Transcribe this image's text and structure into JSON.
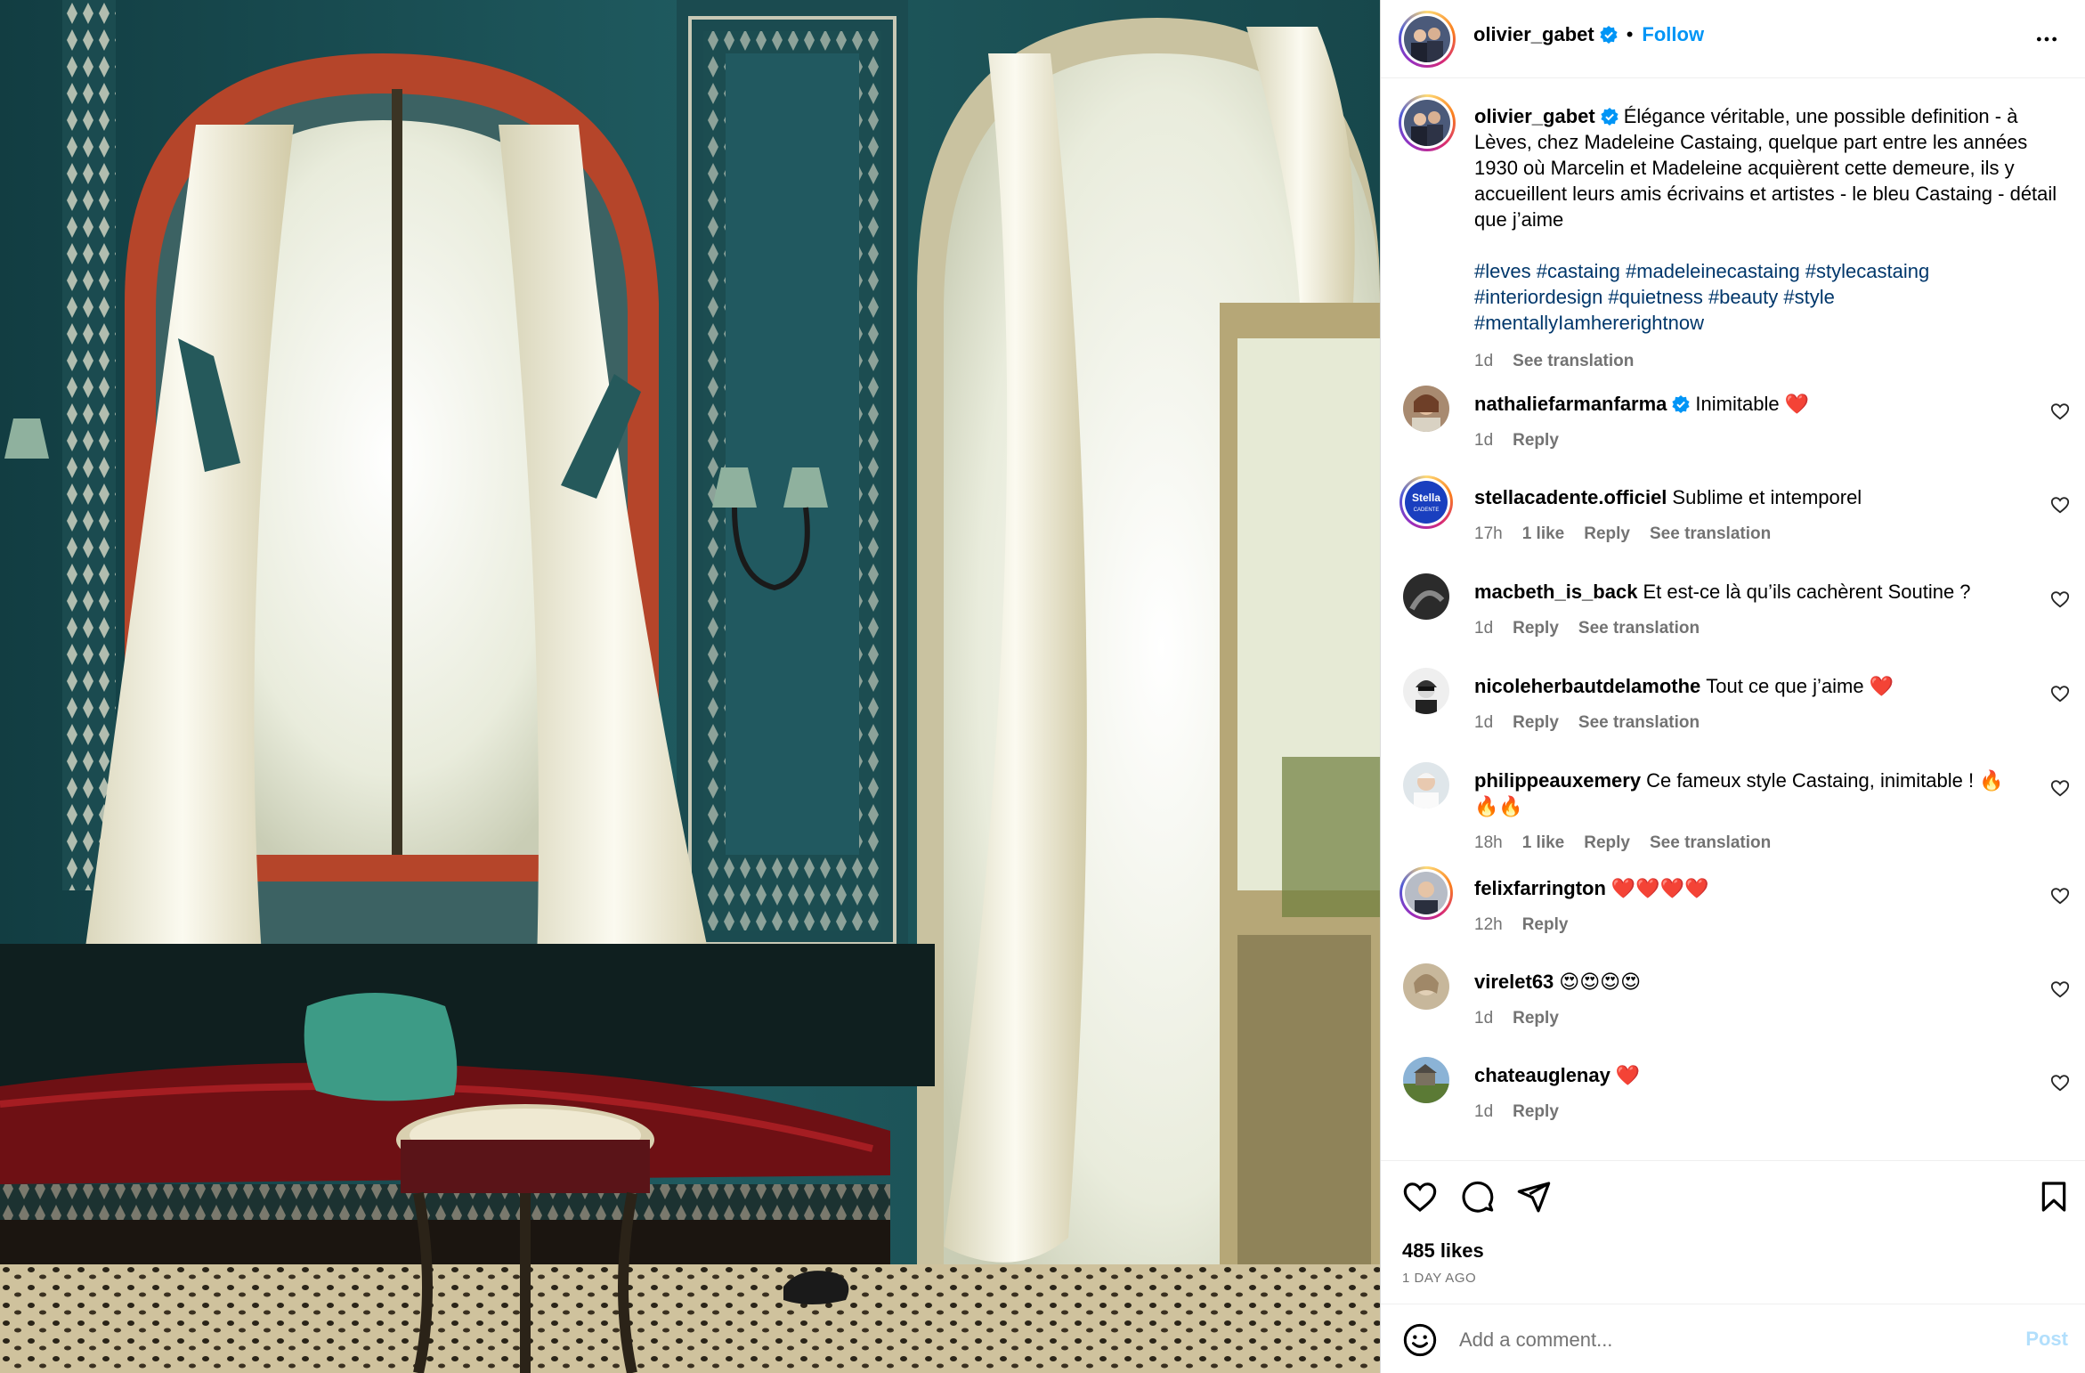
{
  "post": {
    "author": "olivier_gabet",
    "follow_label": "Follow",
    "dot": "•",
    "caption_text": "Élégance véritable, une possible definition - à Lèves, chez Madeleine Castaing, quelque part entre les années 1930 où Marcelin et Madeleine acquièrent cette demeure, ils y accueillent leurs amis écrivains et artistes - le bleu Castaing - détail que j’aime",
    "hashtags": "#leves #castaing #madeleinecastaing #stylecastaing #interiordesign #quietness #beauty #style #mentallyIamhererightnow",
    "caption_time": "1d",
    "see_translation": "See translation",
    "likes": "485 likes",
    "ago": "1 DAY AGO",
    "add_comment_placeholder": "Add a comment...",
    "post_label": "Post"
  },
  "comments": [
    {
      "user": "nathaliefarmanfarma",
      "text": "Inimitable ❤️",
      "time": "1d",
      "likes": "",
      "reply": "Reply",
      "translate": "",
      "verified": true,
      "ring": false
    },
    {
      "user": "stellacadente.officiel",
      "text": "Sublime et intemporel",
      "time": "17h",
      "likes": "1 like",
      "reply": "Reply",
      "translate": "See translation",
      "verified": false,
      "ring": true
    },
    {
      "user": "macbeth_is_back",
      "text": "Et est-ce là qu’ils cachèrent Soutine ?",
      "time": "1d",
      "likes": "",
      "reply": "Reply",
      "translate": "See translation",
      "verified": false,
      "ring": false
    },
    {
      "user": "nicoleherbautdelamothe",
      "text": "Tout ce que j’aime ❤️",
      "time": "1d",
      "likes": "",
      "reply": "Reply",
      "translate": "See translation",
      "verified": false,
      "ring": false
    },
    {
      "user": "philippeauxemery",
      "text": "Ce fameux style Castaing, inimitable ! 🔥🔥🔥",
      "time": "18h",
      "likes": "1 like",
      "reply": "Reply",
      "translate": "See translation",
      "verified": false,
      "ring": false
    },
    {
      "user": "felixfarrington",
      "text": "❤️❤️❤️❤️",
      "time": "12h",
      "likes": "",
      "reply": "Reply",
      "translate": "",
      "verified": false,
      "ring": true
    },
    {
      "user": "virelet63",
      "text": "😍😍😍😍",
      "time": "1d",
      "likes": "",
      "reply": "Reply",
      "translate": "",
      "verified": false,
      "ring": false
    },
    {
      "user": "chateauglenay",
      "text": "❤️",
      "time": "1d",
      "likes": "",
      "reply": "Reply",
      "translate": "",
      "verified": false,
      "ring": false
    }
  ],
  "avatars": {
    "stella_logo_text": "Stella",
    "stella_logo_sub": "CADENTE"
  },
  "colors": {
    "link": "#0095f6",
    "hashtag": "#00376b",
    "muted": "#737373",
    "verified": "#0095f6"
  }
}
